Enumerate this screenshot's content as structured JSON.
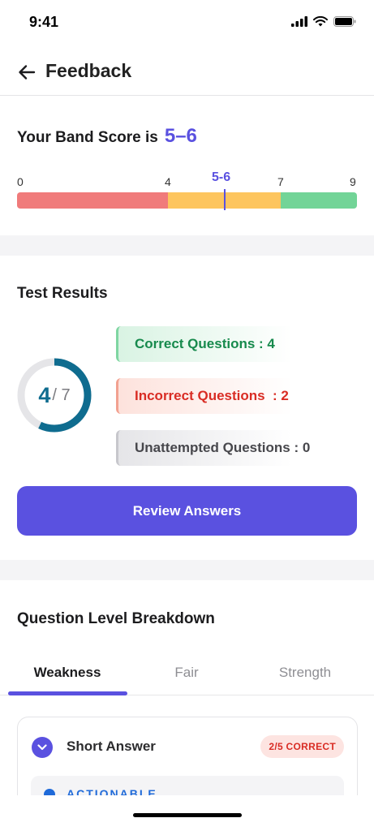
{
  "status": {
    "time": "9:41"
  },
  "header": {
    "title": "Feedback"
  },
  "band": {
    "title": "Your Band Score is",
    "score": "5–6",
    "marker_label": "5-6",
    "scale_labels": [
      "0",
      "4",
      "7",
      "9"
    ],
    "segment_colors": [
      "#f07b7b",
      "#fdc55e",
      "#72d497"
    ]
  },
  "results": {
    "title": "Test Results",
    "correct_count": "4",
    "total_label": "/ 7",
    "progress_fraction": 0.571,
    "correct": "Correct Questions : 4",
    "incorrect": "Incorrect Questions  : 2",
    "unattempted": "Unattempted Questions : 0",
    "review_button": "Review Answers"
  },
  "breakdown": {
    "title": "Question Level Breakdown",
    "tabs": [
      {
        "label": "Weakness",
        "active": true
      },
      {
        "label": "Fair",
        "active": false
      },
      {
        "label": "Strength",
        "active": false
      }
    ],
    "card": {
      "title": "Short Answer",
      "badge": "2/5 CORRECT",
      "actionable_label": "ACTIONABLE"
    }
  },
  "colors": {
    "accent": "#5a51e0",
    "donut_progress": "#0f6c8f",
    "donut_track": "#e5e5e8"
  }
}
